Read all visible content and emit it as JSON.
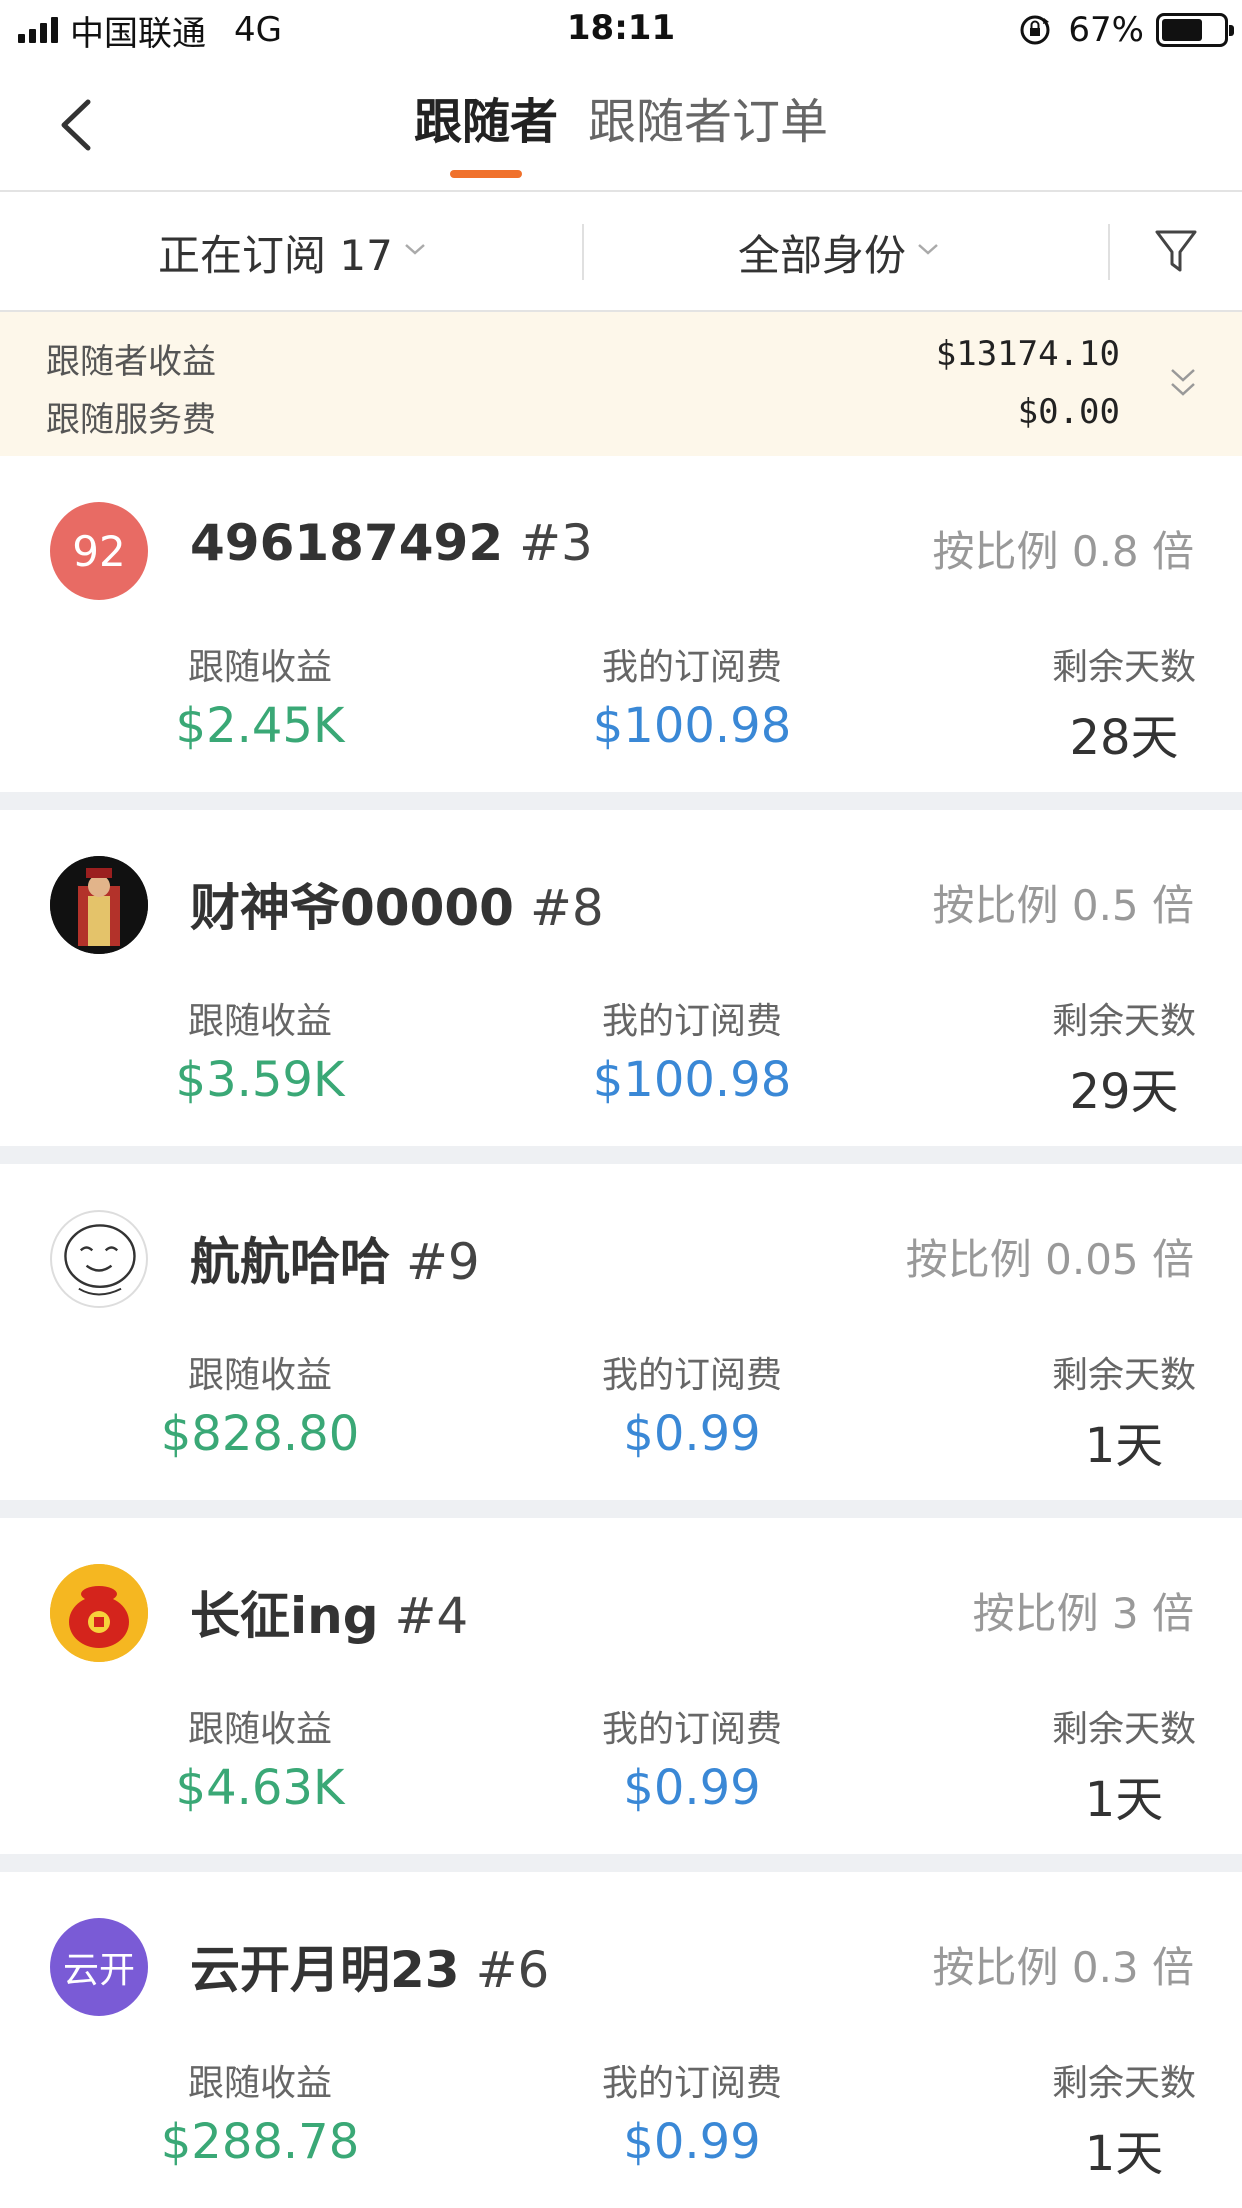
{
  "status_bar": {
    "carrier": "中国联通",
    "network": "4G",
    "time": "18:11",
    "battery": "67%"
  },
  "nav": {
    "tabs": [
      {
        "label": "跟随者",
        "active": true
      },
      {
        "label": "跟随者订单",
        "active": false
      }
    ],
    "accent_color": "#f0712c"
  },
  "filters": {
    "subscribing": "正在订阅 17",
    "identity": "全部身份"
  },
  "summary": {
    "earnings_label": "跟随者收益",
    "earnings_value": "$13174.10",
    "fee_label": "跟随服务费",
    "fee_value": "$0.00"
  },
  "column_labels": {
    "earnings": "跟随收益",
    "subscription_fee": "我的订阅费",
    "days_left": "剩余天数"
  },
  "followers": [
    {
      "avatar_text": "92",
      "avatar_color": "#e86b64",
      "name": "496187492",
      "rank": "#3",
      "ratio": "按比例 0.8 倍",
      "earnings": "$2.45K",
      "fee": "$100.98",
      "days": "28天"
    },
    {
      "avatar_text": "",
      "avatar_color": "#1a1a1a",
      "name": "财神爷00000",
      "rank": "#8",
      "ratio": "按比例 0.5 倍",
      "earnings": "$3.59K",
      "fee": "$100.98",
      "days": "29天"
    },
    {
      "avatar_text": "",
      "avatar_color": "#ffffff",
      "name": "航航哈哈",
      "rank": "#9",
      "ratio": "按比例 0.05 倍",
      "earnings": "$828.80",
      "fee": "$0.99",
      "days": "1天"
    },
    {
      "avatar_text": "",
      "avatar_color": "#f5b721",
      "name": "长征ing",
      "rank": "#4",
      "ratio": "按比例 3 倍",
      "earnings": "$4.63K",
      "fee": "$0.99",
      "days": "1天"
    },
    {
      "avatar_text": "云开",
      "avatar_color": "#7a5bd6",
      "name": "云开月明23",
      "rank": "#6",
      "ratio": "按比例 0.3 倍",
      "earnings": "$288.78",
      "fee": "$0.99",
      "days": "1天"
    }
  ],
  "colors": {
    "earnings_green": "#3aa876",
    "fee_blue": "#3a88d6",
    "summary_bg": "#fdf7ea"
  }
}
